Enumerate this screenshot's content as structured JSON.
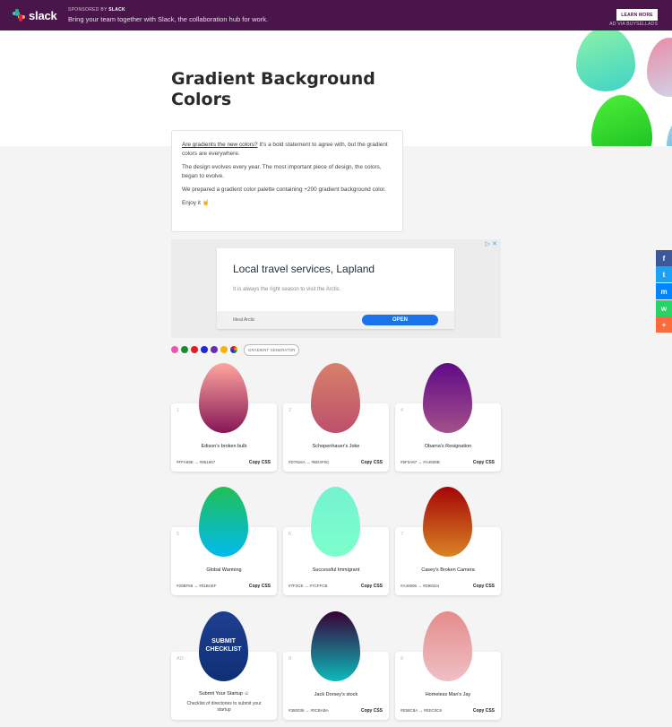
{
  "adbar": {
    "brand": "slack",
    "sponsored_prefix": "SPONSORED BY",
    "sponsored_brand": "SLACK",
    "tagline": "Bring your team together with Slack, the collaboration hub for work.",
    "cta": "LEARN MORE",
    "ad_via": "AD VIA BUYSELLADS",
    "colors": {
      "bar": "#4a154b"
    }
  },
  "page": {
    "title": "Gradient Background Colors"
  },
  "intro": {
    "link": "Are gradients the new colors?",
    "line1_rest": " It's a bold statement to agree with, but the gradient colors are everywhere.",
    "line2": "The design evolves every year. The most important piece of design, the colors, began to evolve.",
    "line3": "We prepared a gradient color palette containing +200 gradient background color.",
    "line4": "Enjoy it 🤘"
  },
  "inline_ad": {
    "headline": "Local travel services, Lapland",
    "body": "It is always the right season to visit the Arctic.",
    "advertiser": "Ideal Arctic",
    "cta": "OPEN",
    "close": "▷ ✕"
  },
  "filters": {
    "colors": [
      "#e85aa8",
      "#1e8a2e",
      "#e21b1b",
      "#1c2bd6",
      "#6a2bb8",
      "#f2b40c",
      "#multi"
    ],
    "generator_label": "GRADIENT GENERATOR"
  },
  "cards": [
    {
      "num": "1",
      "name": "Edison's broken bulb",
      "codes": "#FFA69E → #861657",
      "copy": "Copy CSS",
      "from": "#FFA69E",
      "to": "#861657"
    },
    {
      "num": "2",
      "name": "Schopenhauer's Joke",
      "codes": "#D7816A → #BD4F6C",
      "copy": "Copy CSS",
      "from": "#D7816A",
      "to": "#BD4F6C"
    },
    {
      "num": "4",
      "name": "Obama's Resignation",
      "codes": "#5F0A87 → #A4508B",
      "copy": "Copy CSS",
      "from": "#5F0A87",
      "to": "#A4508B"
    },
    {
      "num": "5",
      "name": "Global Warming",
      "codes": "#20BF55 → #01BAEF",
      "copy": "Copy CSS",
      "from": "#20BF55",
      "to": "#01BAEF"
    },
    {
      "num": "6",
      "name": "Successful Immigrant",
      "codes": "#7F2CE → #7CFFCB",
      "copy": "Copy CSS",
      "from": "#74F2CE",
      "to": "#7CFFCB"
    },
    {
      "num": "7",
      "name": "Casey's Broken Camera",
      "codes": "#A40606 → #D98324",
      "copy": "Copy CSS",
      "from": "#A40606",
      "to": "#D98324"
    },
    {
      "num": "AD",
      "name": "Submit Your Startup ☺",
      "sub": "Checklist of directories to submit your startup",
      "egg_text": "SUBMIT CHECKLIST",
      "from": "#1d3f8f",
      "to": "#0f2f76"
    },
    {
      "num": "8",
      "name": "Jack Dorsey's stock",
      "codes": "#380036 → #0CBABA",
      "copy": "Copy CSS",
      "from": "#380036",
      "to": "#0CBABA"
    },
    {
      "num": "9",
      "name": "Homeless Man's Jay",
      "codes": "#E58C8A → #EEC0C6",
      "copy": "Copy CSS",
      "from": "#E58C8A",
      "to": "#EEC0C6"
    }
  ],
  "social": [
    {
      "icon": "facebook-icon",
      "glyph": "f",
      "color": "#3b5998"
    },
    {
      "icon": "twitter-icon",
      "glyph": "t",
      "color": "#1da1f2"
    },
    {
      "icon": "messenger-icon",
      "glyph": "m",
      "color": "#0084ff"
    },
    {
      "icon": "whatsapp-icon",
      "glyph": "w",
      "color": "#25d366"
    },
    {
      "icon": "more-icon",
      "glyph": "+",
      "color": "#ff6a3d"
    }
  ]
}
